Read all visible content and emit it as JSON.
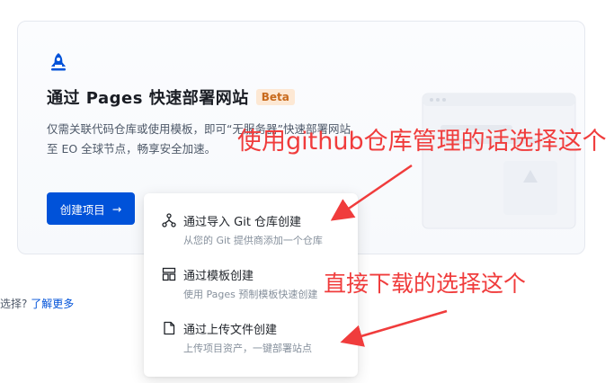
{
  "card": {
    "title": "通过 Pages 快速部署网站",
    "badge": "Beta",
    "desc_line1": "仅需关联代码仓库或使用模板，即可“无服务器”快速部署网站",
    "desc_line2": "至 EO 全球节点，畅享安全加速。",
    "create_button": "创建项目",
    "create_arrow": "→"
  },
  "hint": {
    "prefix": "选择?",
    "link": "了解更多"
  },
  "menu": {
    "items": [
      {
        "title": "通过导入 Git 仓库创建",
        "subtitle": "从您的 Git 提供商添加一个仓库",
        "icon": "git-branch-icon"
      },
      {
        "title": "通过模板创建",
        "subtitle": "使用 Pages 预制模板快速创建",
        "icon": "template-icon"
      },
      {
        "title": "通过上传文件创建",
        "subtitle": "上传项目资产，一键部署站点",
        "icon": "file-icon"
      }
    ]
  },
  "annotations": {
    "github": "使用github仓库管理的话选择这个",
    "download": "直接下载的选择这个"
  },
  "colors": {
    "primary": "#0052d9",
    "annotation": "#f03c3c",
    "badge_bg": "#fde8d4"
  }
}
